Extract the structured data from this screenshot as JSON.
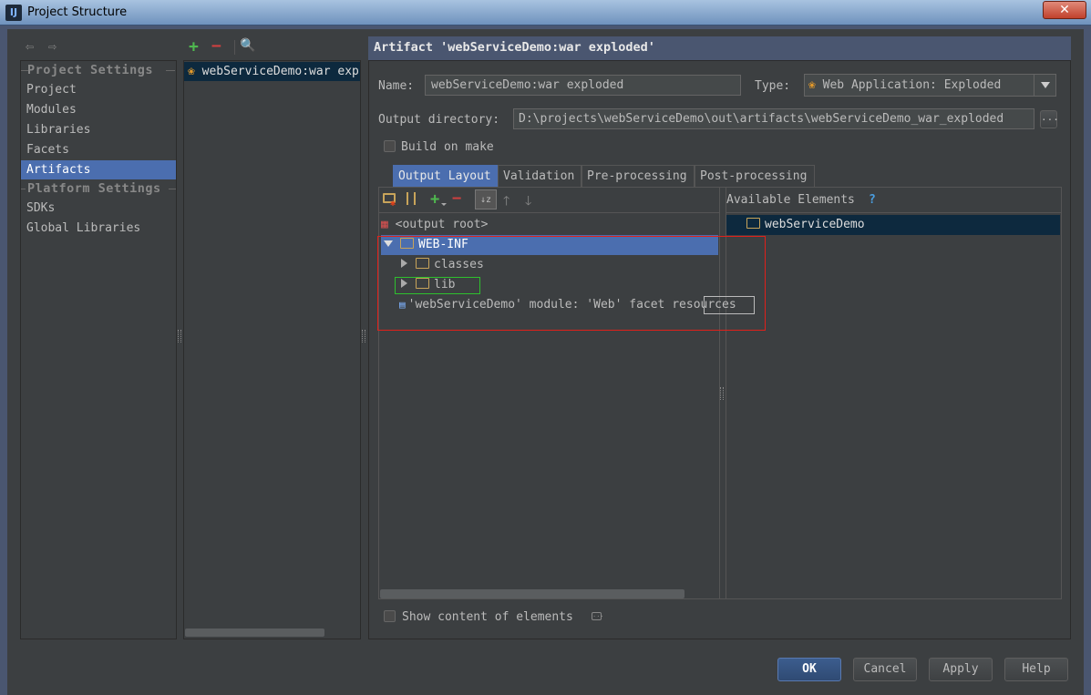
{
  "window": {
    "title": "Project Structure",
    "app_icon": "jetbrains-idea-icon",
    "close_label": "✕"
  },
  "colors": {
    "selection": "#4b6eaf",
    "highlight_red": "#e0201a",
    "highlight_green": "#2ec02e"
  },
  "nav": {
    "project_settings_header": "Project Settings",
    "project_items": [
      "Project",
      "Modules",
      "Libraries",
      "Facets",
      "Artifacts"
    ],
    "platform_settings_header": "Platform Settings",
    "platform_items": [
      "SDKs",
      "Global Libraries"
    ],
    "selected": "Artifacts"
  },
  "artifact_list": {
    "items": [
      "webServiceDemo:war exp"
    ]
  },
  "artifact": {
    "header": "Artifact 'webServiceDemo:war exploded'",
    "name_label": "Name:",
    "name_value": "webServiceDemo:war exploded",
    "type_label": "Type:",
    "type_value": "Web Application: Exploded",
    "output_dir_label": "Output directory:",
    "output_dir_value": "D:\\projects\\webServiceDemo\\out\\artifacts\\webServiceDemo_war_exploded",
    "browse_label": "...",
    "build_on_make_label": "Build on make",
    "build_on_make_checked": false
  },
  "tabs": [
    "Output Layout",
    "Validation",
    "Pre-processing",
    "Post-processing"
  ],
  "active_tab": "Output Layout",
  "layout_tree": {
    "root": "<output root>",
    "web_inf": "WEB-INF",
    "classes": "classes",
    "lib": "lib",
    "facet_resources": "'webServiceDemo' module: 'Web' facet resources"
  },
  "available": {
    "header": "Available Elements",
    "help": "?",
    "items": [
      "webServiceDemo"
    ]
  },
  "show_content_label": "Show content of elements",
  "buttons": {
    "ok": "OK",
    "cancel": "Cancel",
    "apply": "Apply",
    "help": "Help"
  }
}
